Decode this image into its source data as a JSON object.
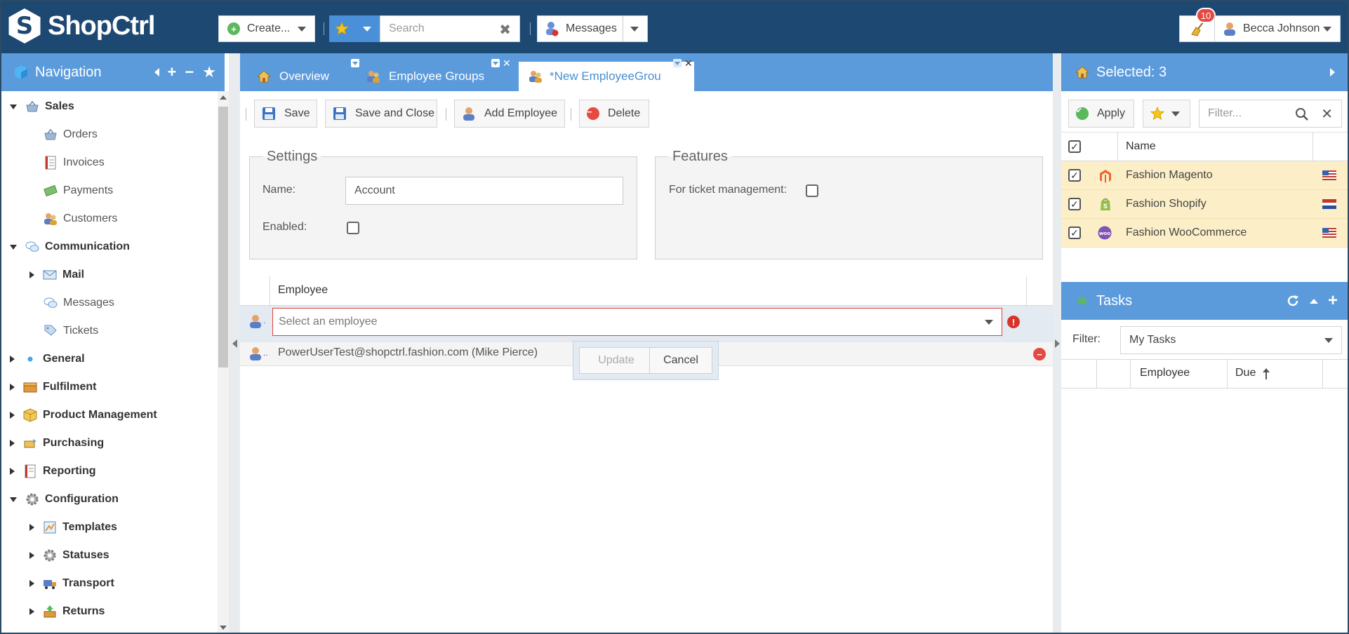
{
  "app": {
    "logo_text": "ShopCtrl"
  },
  "topbar": {
    "create_label": "Create...",
    "search_placeholder": "Search",
    "messages_label": "Messages",
    "notification_count": "10",
    "user_name": "Becca Johnson"
  },
  "navigation": {
    "title": "Navigation",
    "items": [
      {
        "label": "Sales",
        "icon": "shopping-basket-icon"
      },
      {
        "label": "Orders",
        "icon": "shopping-basket-icon"
      },
      {
        "label": "Invoices",
        "icon": "invoice-icon"
      },
      {
        "label": "Payments",
        "icon": "money-icon"
      },
      {
        "label": "Customers",
        "icon": "customers-icon"
      },
      {
        "label": "Communication",
        "icon": "speech-bubbles-icon"
      },
      {
        "label": "Mail",
        "icon": "envelope-icon"
      },
      {
        "label": "Messages",
        "icon": "speech-bubbles-icon"
      },
      {
        "label": "Tickets",
        "icon": "tag-icon"
      },
      {
        "label": "General",
        "icon": "dot-icon"
      },
      {
        "label": "Fulfilment",
        "icon": "box-icon"
      },
      {
        "label": "Product Management",
        "icon": "package-icon"
      },
      {
        "label": "Purchasing",
        "icon": "purchasing-icon"
      },
      {
        "label": "Reporting",
        "icon": "report-icon"
      },
      {
        "label": "Configuration",
        "icon": "gear-icon"
      },
      {
        "label": "Templates",
        "icon": "template-icon"
      },
      {
        "label": "Statuses",
        "icon": "gear-icon"
      },
      {
        "label": "Transport",
        "icon": "truck-icon"
      },
      {
        "label": "Returns",
        "icon": "returns-icon"
      }
    ]
  },
  "tabs": [
    {
      "label": "Overview"
    },
    {
      "label": "Employee Groups"
    },
    {
      "label": "*New EmployeeGrou"
    }
  ],
  "toolbar": {
    "save": "Save",
    "save_close": "Save and Close",
    "add_employee": "Add Employee",
    "delete": "Delete"
  },
  "settings": {
    "legend": "Settings",
    "name_label": "Name:",
    "name_value": "Account",
    "enabled_label": "Enabled:"
  },
  "features": {
    "legend": "Features",
    "ticket_label": "For ticket management:"
  },
  "grid": {
    "column_employee": "Employee",
    "select_placeholder": "Select an employee",
    "row_employee": "PowerUserTest@shopctrl.fashion.com (Mike Pierce)",
    "row_marker": "..",
    "edit_marker": "."
  },
  "popup": {
    "update": "Update",
    "cancel": "Cancel"
  },
  "selected": {
    "title": "Selected: 3",
    "apply": "Apply",
    "filter_placeholder": "Filter...",
    "column_name": "Name",
    "rows": [
      {
        "name": "Fashion Magento",
        "icon": "magento-icon",
        "flag": "us-flag"
      },
      {
        "name": "Fashion Shopify",
        "icon": "shopify-icon",
        "flag": "nl-flag"
      },
      {
        "name": "Fashion WooCommerce",
        "icon": "woocommerce-icon",
        "flag": "us-flag"
      }
    ]
  },
  "tasks": {
    "title": "Tasks",
    "filter_label": "Filter:",
    "filter_value": "My Tasks",
    "col_employee": "Employee",
    "col_due": "Due"
  },
  "colors": {
    "topbar": "#1d4872",
    "header_blue": "#5b9bdc",
    "selected_row": "#fcefc8",
    "error": "#e0433d"
  }
}
